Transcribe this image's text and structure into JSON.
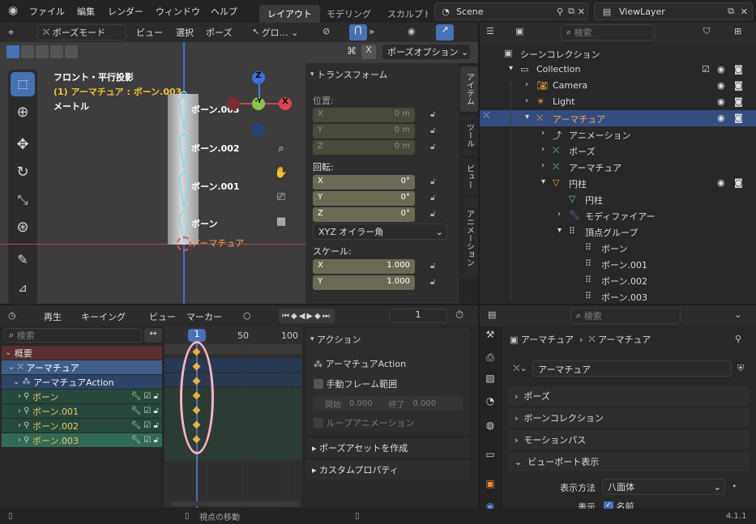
{
  "topbar": {
    "menus": [
      "ファイル",
      "編集",
      "レンダー",
      "ウィンドウ",
      "ヘルプ"
    ],
    "tabs": [
      "レイアウト",
      "モデリング",
      "スカルプト"
    ],
    "scene": "Scene",
    "view_layer": "ViewLayer"
  },
  "viewport": {
    "mode": "ポーズモード",
    "menus": [
      "ビュー",
      "選択",
      "ポーズ"
    ],
    "transform_orient": "グロ…",
    "overlay_title": "フロント・平行投影",
    "overlay_sub": "(1) アーマチュア : ボーン.003",
    "overlay_unit": "メートル",
    "pose_options": "ポーズオプション",
    "bone_labels": [
      "ボーン.003",
      "ボーン.002",
      "ボーン.001",
      "ボーン",
      "アーマチュア"
    ],
    "axes": {
      "z": "Z",
      "y": "-Y",
      "x": "X"
    }
  },
  "npanel": {
    "title": "トランスフォーム",
    "location_label": "位置:",
    "location": [
      {
        "axis": "X",
        "value": "0 m"
      },
      {
        "axis": "Y",
        "value": "0 m"
      },
      {
        "axis": "Z",
        "value": "0 m"
      }
    ],
    "rotation_label": "回転:",
    "rotation": [
      {
        "axis": "X",
        "value": "0°"
      },
      {
        "axis": "Y",
        "value": "0°"
      },
      {
        "axis": "Z",
        "value": "0°"
      }
    ],
    "euler": "XYZ オイラー角",
    "scale_label": "スケール:",
    "scale": [
      {
        "axis": "X",
        "value": "1.000"
      },
      {
        "axis": "Y",
        "value": "1.000"
      }
    ],
    "tabs": [
      "アイテム",
      "ツール",
      "ビュー",
      "アニメーション"
    ]
  },
  "outliner": {
    "search_placeholder": "検索",
    "title": "シーンコレクション",
    "items": [
      {
        "label": "Collection"
      },
      {
        "label": "Camera"
      },
      {
        "label": "Light"
      },
      {
        "label": "アーマチュア"
      },
      {
        "label": "アニメーション"
      },
      {
        "label": "ポーズ"
      },
      {
        "label": "アーマチュア"
      },
      {
        "label": "円柱"
      },
      {
        "label": "円柱"
      },
      {
        "label": "モディファイアー"
      },
      {
        "label": "頂点グループ"
      },
      {
        "label": "ボーン"
      },
      {
        "label": "ボーン.001"
      },
      {
        "label": "ボーン.002"
      },
      {
        "label": "ボーン.003"
      }
    ]
  },
  "timeline": {
    "playback": "再生",
    "keying": "キーイング",
    "view": "ビュー",
    "marker": "マーカー",
    "current_frame": "1"
  },
  "dopesheet": {
    "search_placeholder": "検索",
    "frames": [
      "1",
      "50",
      "100"
    ],
    "rows": [
      {
        "label": "概要"
      },
      {
        "label": "アーマチュア"
      },
      {
        "label": "アーマチュアAction"
      },
      {
        "label": "ボーン"
      },
      {
        "label": "ボーン.001"
      },
      {
        "label": "ボーン.002"
      },
      {
        "label": "ボーン.003"
      }
    ],
    "action_panel": {
      "title": "アクション",
      "action_name": "アーマチュアAction",
      "manual_range": "手動フレーム範囲",
      "start_label": "開始",
      "start_value": "0.000",
      "end_label": "終了",
      "end_value": "0.000",
      "loop": "ループアニメーション",
      "pose_asset": "ポーズアセットを作成",
      "custom_props": "カスタムプロパティ"
    }
  },
  "properties": {
    "search_placeholder": "検索",
    "breadcrumb": [
      "アーマチュア",
      "アーマチュア"
    ],
    "datablock": "アーマチュア",
    "sections": [
      "ポーズ",
      "ボーンコレクション",
      "モーションパス",
      "ビューポート表示"
    ],
    "display_as_label": "表示方法",
    "display_as_value": "八面体",
    "show_label": "表示",
    "names_label": "名前"
  },
  "statusbar": {
    "hint": "視点の移動",
    "version": "4.1.1"
  }
}
